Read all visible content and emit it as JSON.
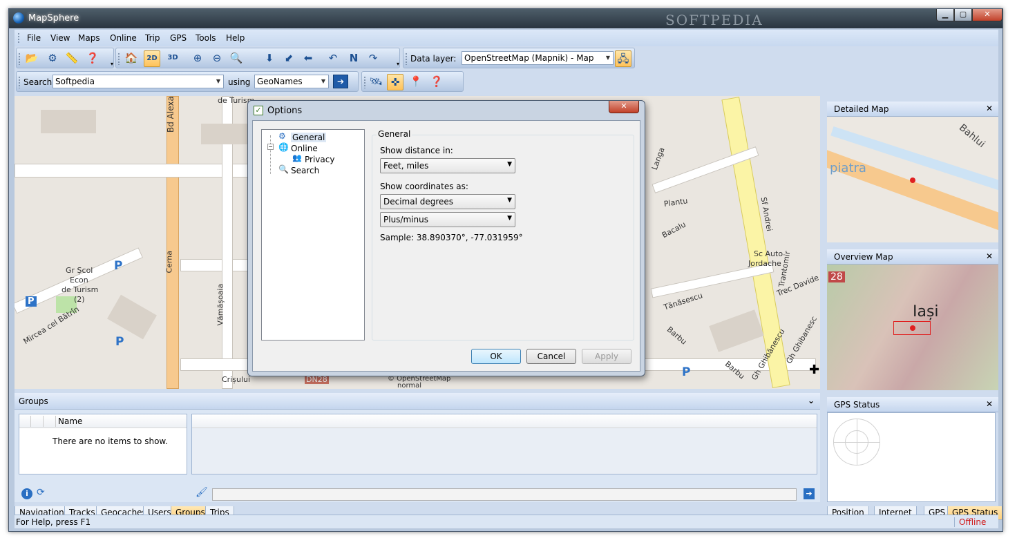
{
  "window": {
    "title": "MapSphere",
    "watermark": "SOFTPEDIA"
  },
  "menu": [
    "File",
    "View",
    "Maps",
    "Online",
    "Trip",
    "GPS",
    "Tools",
    "Help"
  ],
  "toolbar": {
    "data_layer_label": "Data layer:",
    "data_layer_value": "OpenStreetMap (Mapnik) - Map",
    "btn_2d": "2D",
    "btn_3d": "3D"
  },
  "searchbar": {
    "label": "Search",
    "value": "Softpedia",
    "using_label": "using",
    "provider": "GeoNames"
  },
  "map": {
    "labels": [
      "de Turism",
      "Bd Alexandri",
      "Gr Școl",
      "Econ",
      "de Turism",
      "(2)",
      "Cerna",
      "Mircea cel Bătrîn",
      "Vămășoaia",
      "Crișului",
      "DN28",
      "© OpenStreetMap",
      "normal",
      "Sf Andrei",
      "Sc Auto",
      "Jordache",
      "Trantomir",
      "Trec Davide",
      "Tănăsescu",
      "Barbu",
      "Barbu",
      "Gh Ghibănescu",
      "Gh Ghibanesc",
      "Bacalu",
      "Plantu",
      "Langa"
    ],
    "parking": "P"
  },
  "dialog": {
    "title": "Options",
    "tree": [
      {
        "label": "General"
      },
      {
        "label": "Online"
      },
      {
        "label": "Privacy"
      },
      {
        "label": "Search"
      }
    ],
    "group_title": "General",
    "distance_label": "Show distance in:",
    "distance_value": "Feet, miles",
    "coords_label": "Show coordinates as:",
    "coords_value": "Decimal degrees",
    "sign_value": "Plus/minus",
    "sample": "Sample: 38.890370°, -77.031959°",
    "ok": "OK",
    "cancel": "Cancel",
    "apply": "Apply"
  },
  "right_panels": {
    "detailed": "Detailed Map",
    "overview": "Overview Map",
    "gps": "GPS Status",
    "overview_city": "Iași",
    "detailed_label": "piatra",
    "detailed_street": "Bahlui",
    "overview_road": "28"
  },
  "groups": {
    "title": "Groups",
    "col_name": "Name",
    "empty": "There are no items to show."
  },
  "bottom_tabs": [
    "Navigation",
    "Tracks",
    "Geocaches",
    "Users",
    "Groups",
    "Trips"
  ],
  "right_tabs": [
    "Position",
    "Internet",
    "GPS",
    "GPS Status"
  ],
  "status": {
    "help": "For Help, press F1",
    "state": "Offline"
  }
}
